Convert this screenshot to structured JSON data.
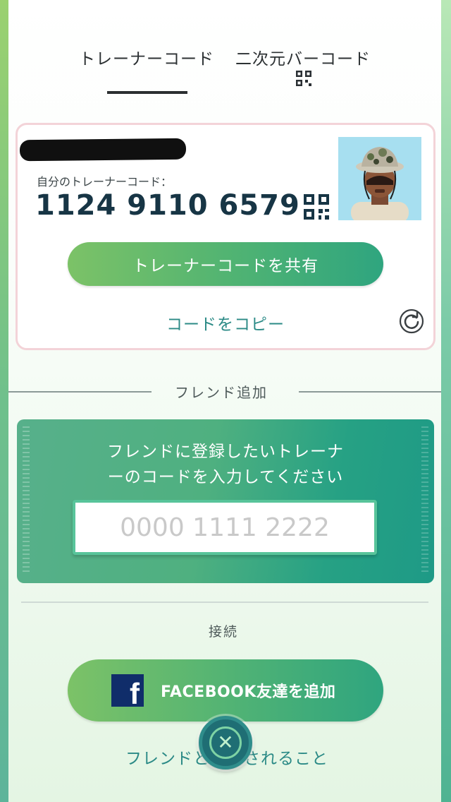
{
  "tabs": {
    "trainer_code": "トレーナーコード",
    "qr_code": "二次元バーコード"
  },
  "card": {
    "own_code_label": "自分のトレーナーコード：",
    "own_code": "1124 9110 6579",
    "share_button": "トレーナーコードを共有",
    "copy_link": "コードをコピー"
  },
  "friend_add": {
    "section_title": "フレンド追加",
    "prompt_line1": "フレンドに登録したいトレーナ",
    "prompt_line2": "ーのコードを入力してください",
    "input_placeholder": "0000 1111 2222",
    "input_value": ""
  },
  "connect": {
    "section_title": "接続",
    "facebook_button": "FACEBOOK友達を追加",
    "facebook_logo": "f"
  },
  "bottom_link": "フレンドと　　されること",
  "icons": {
    "qr": "qr-code-icon",
    "refresh": "refresh-icon",
    "close": "close-icon"
  },
  "colors": {
    "accent_green": "#52b472",
    "link_teal": "#2b8a86",
    "code_text": "#173545",
    "card_border": "#f3d3d8"
  }
}
